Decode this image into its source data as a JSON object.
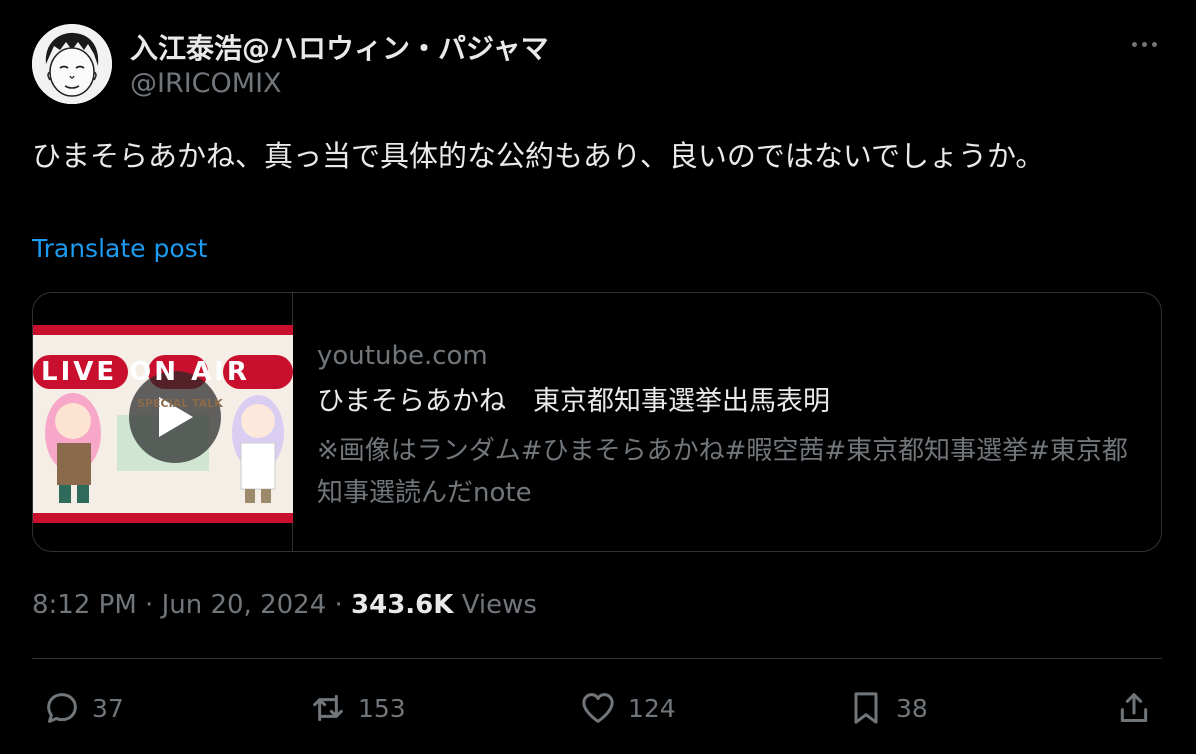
{
  "author": {
    "display_name": "入江泰浩@ハロウィン・パジャマ",
    "handle": "@IRICOMIX"
  },
  "tweet": {
    "text": "ひまそらあかね、真っ当で具体的な公約もあり、良いのではないでしょうか。",
    "translate_label": "Translate post"
  },
  "link_card": {
    "domain": "youtube.com",
    "title": "ひまそらあかね　東京都知事選挙出馬表明",
    "description": "※画像はランダム#ひまそらあかね#暇空茜#東京都知事選挙#東京都知事選読んだnote",
    "thumbnail": {
      "banner_text": "LIVE ON AIR",
      "sub_text": "SPECIAL TALK"
    }
  },
  "meta": {
    "time": "8:12 PM",
    "date": "Jun 20, 2024",
    "views_count": "343.6K",
    "views_label": "Views"
  },
  "actions": {
    "replies": "37",
    "reposts": "153",
    "likes": "124",
    "bookmarks": "38"
  },
  "colors": {
    "background": "#000000",
    "text_primary": "#e7e9ea",
    "text_secondary": "#71767b",
    "link": "#1d9bf0",
    "border": "#2f3336"
  }
}
